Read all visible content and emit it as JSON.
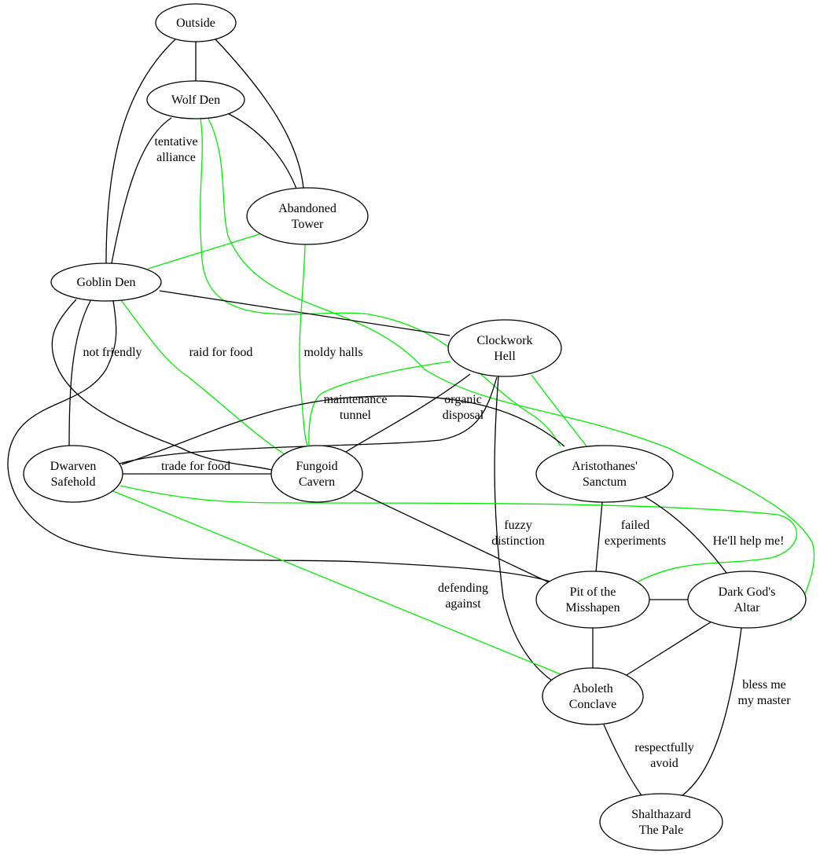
{
  "colors": {
    "relation": "#000000",
    "secret": "#00ee00",
    "node_stroke": "#000000",
    "background": "#ffffff"
  },
  "nodes": [
    {
      "id": "outside",
      "label": [
        "Outside"
      ]
    },
    {
      "id": "wolf",
      "label": [
        "Wolf Den"
      ]
    },
    {
      "id": "tower",
      "label": [
        "Abandoned",
        "Tower"
      ]
    },
    {
      "id": "goblin",
      "label": [
        "Goblin Den"
      ]
    },
    {
      "id": "clockwork",
      "label": [
        "Clockwork",
        "Hell"
      ]
    },
    {
      "id": "dwarven",
      "label": [
        "Dwarven",
        "Safehold"
      ]
    },
    {
      "id": "fungoid",
      "label": [
        "Fungoid",
        "Cavern"
      ]
    },
    {
      "id": "aristo",
      "label": [
        "Aristothanes'",
        "Sanctum"
      ]
    },
    {
      "id": "pit",
      "label": [
        "Pit of the",
        "Misshapen"
      ]
    },
    {
      "id": "darkgod",
      "label": [
        "Dark God's",
        "Altar"
      ]
    },
    {
      "id": "aboleth",
      "label": [
        "Aboleth",
        "Conclave"
      ]
    },
    {
      "id": "shal",
      "label": [
        "Shalthazard",
        "The Pale"
      ]
    }
  ],
  "edges": [
    {
      "from": "outside",
      "to": "wolf",
      "kind": "relation",
      "label": []
    },
    {
      "from": "outside",
      "to": "goblin",
      "kind": "relation",
      "label": []
    },
    {
      "from": "outside",
      "to": "tower",
      "kind": "relation",
      "label": []
    },
    {
      "from": "wolf",
      "to": "tower",
      "kind": "relation",
      "label": []
    },
    {
      "from": "wolf",
      "to": "goblin",
      "kind": "relation",
      "label": [
        "tentative",
        "alliance"
      ]
    },
    {
      "from": "wolf",
      "to": "aristo",
      "kind": "secret",
      "label": []
    },
    {
      "from": "wolf",
      "to": "darkgod",
      "kind": "secret",
      "label": []
    },
    {
      "from": "tower",
      "to": "goblin",
      "kind": "secret",
      "label": []
    },
    {
      "from": "tower",
      "to": "fungoid",
      "kind": "relation",
      "label": [
        "moldy halls"
      ]
    },
    {
      "from": "tower",
      "to": "clockwork",
      "kind": "relation",
      "label": []
    },
    {
      "from": "goblin",
      "to": "clockwork",
      "kind": "secret",
      "label": []
    },
    {
      "from": "goblin",
      "to": "dwarven",
      "kind": "relation",
      "label": [
        "not friendly"
      ]
    },
    {
      "from": "goblin",
      "to": "fungoid",
      "kind": "relation",
      "label": [
        "raid for food"
      ]
    },
    {
      "from": "goblin",
      "to": "fungoid",
      "kind": "secret",
      "label": []
    },
    {
      "from": "goblin",
      "to": "pit",
      "kind": "secret",
      "label": []
    },
    {
      "from": "clockwork",
      "to": "fungoid",
      "kind": "relation",
      "label": [
        "maintenance",
        "tunnel"
      ]
    },
    {
      "from": "clockwork",
      "to": "fungoid",
      "kind": "relation",
      "label": [
        "organic",
        "disposal"
      ]
    },
    {
      "from": "clockwork",
      "to": "dwarven",
      "kind": "secret",
      "label": []
    },
    {
      "from": "clockwork",
      "to": "aristo",
      "kind": "relation",
      "label": []
    },
    {
      "from": "clockwork",
      "to": "aboleth",
      "kind": "relation",
      "label": [
        "fuzzy",
        "distinction"
      ]
    },
    {
      "from": "dwarven",
      "to": "fungoid",
      "kind": "relation",
      "label": [
        "trade for food"
      ]
    },
    {
      "from": "dwarven",
      "to": "aristo",
      "kind": "secret",
      "label": []
    },
    {
      "from": "dwarven",
      "to": "pit",
      "kind": "secret",
      "label": []
    },
    {
      "from": "dwarven",
      "to": "aboleth",
      "kind": "relation",
      "label": [
        "defending",
        "against"
      ]
    },
    {
      "from": "fungoid",
      "to": "pit",
      "kind": "relation",
      "label": []
    },
    {
      "from": "aristo",
      "to": "pit",
      "kind": "relation",
      "label": [
        "failed",
        "experiments"
      ]
    },
    {
      "from": "aristo",
      "to": "darkgod",
      "kind": "relation",
      "label": [
        "He'll help me!"
      ]
    },
    {
      "from": "pit",
      "to": "darkgod",
      "kind": "relation",
      "label": []
    },
    {
      "from": "pit",
      "to": "aboleth",
      "kind": "relation",
      "label": []
    },
    {
      "from": "darkgod",
      "to": "aboleth",
      "kind": "relation",
      "label": []
    },
    {
      "from": "darkgod",
      "to": "shal",
      "kind": "relation",
      "label": [
        "bless me",
        "my master"
      ]
    },
    {
      "from": "aboleth",
      "to": "shal",
      "kind": "relation",
      "label": [
        "respectfully",
        "avoid"
      ]
    }
  ]
}
